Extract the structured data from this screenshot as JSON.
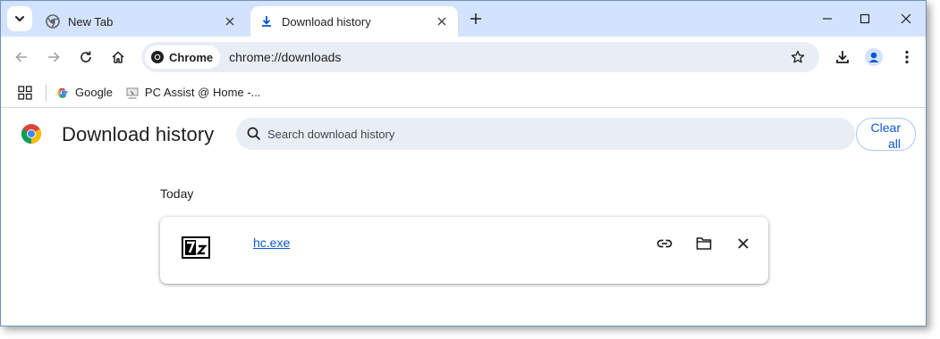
{
  "browser": {
    "tabs": [
      {
        "title": "New Tab",
        "icon": "chrome-icon",
        "active": false
      },
      {
        "title": "Download history",
        "icon": "download-icon",
        "active": true
      }
    ],
    "url_chip": "Chrome",
    "url": "chrome://downloads",
    "bookmarks": [
      {
        "label": "Google",
        "icon": "google-icon"
      },
      {
        "label": "PC Assist @ Home -...",
        "icon": "pc-assist-icon"
      }
    ]
  },
  "page": {
    "title": "Download history",
    "search_placeholder": "Search download history",
    "clear_all_line1": "Clear",
    "clear_all_line2": "all",
    "groups": [
      {
        "date": "Today",
        "items": [
          {
            "filename": "hc.exe",
            "icon": "7zip-icon"
          }
        ]
      }
    ]
  },
  "colors": {
    "tabstrip": "#d3e3fd",
    "omnibox": "#e9eef6",
    "link": "#0b57d0",
    "clear_border": "#a8c7fa"
  }
}
